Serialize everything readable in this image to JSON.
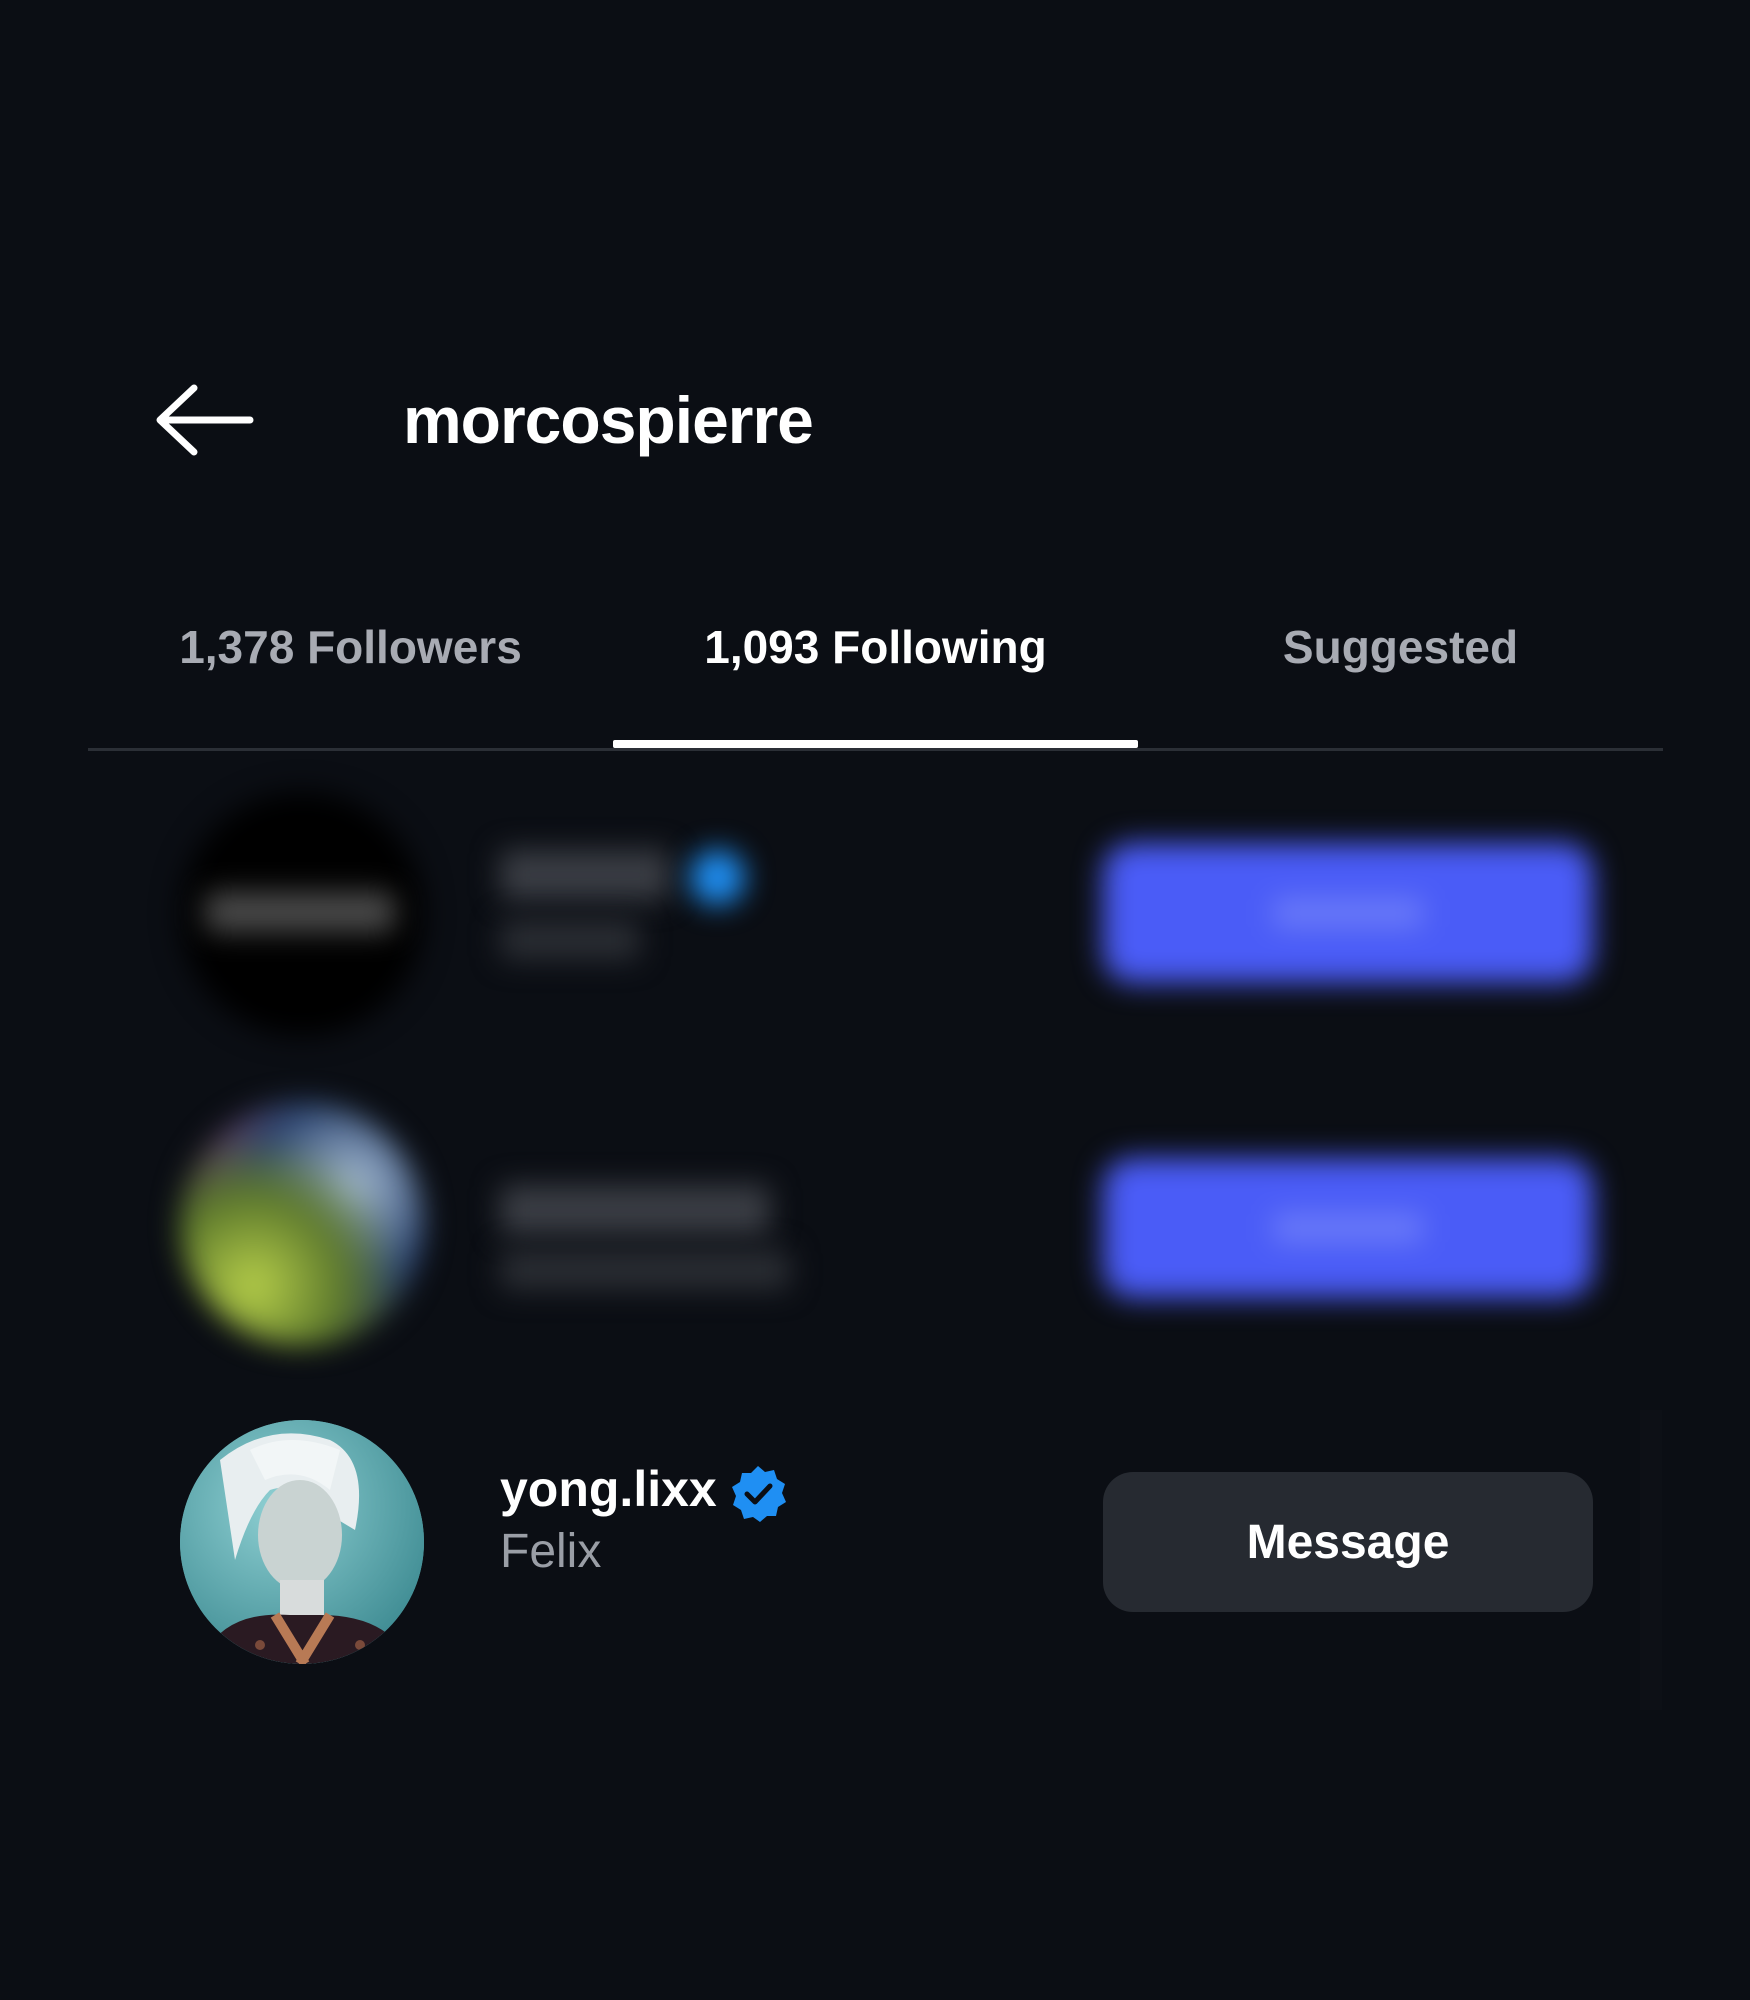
{
  "header": {
    "back_icon": "arrow-left-icon",
    "title": "morcospierre"
  },
  "tabs": [
    {
      "label": "1,378 Followers",
      "active": false
    },
    {
      "label": "1,093 Following",
      "active": true
    },
    {
      "label": "Suggested",
      "active": false
    }
  ],
  "accounts": [
    {
      "username": "",
      "display_name": "",
      "verified": true,
      "button": "Follow",
      "blurred": true
    },
    {
      "username": "",
      "display_name": "",
      "verified": false,
      "button": "Follow",
      "blurred": true
    },
    {
      "username": "yong.lixx",
      "display_name": "Felix",
      "verified": true,
      "button": "Message",
      "blurred": false
    }
  ],
  "colors": {
    "background": "#0b0e14",
    "follow_button": "#4a5cf7",
    "message_button": "#262a31",
    "verified_badge": "#1f8ff3",
    "inactive_tab": "#a8abb3"
  }
}
